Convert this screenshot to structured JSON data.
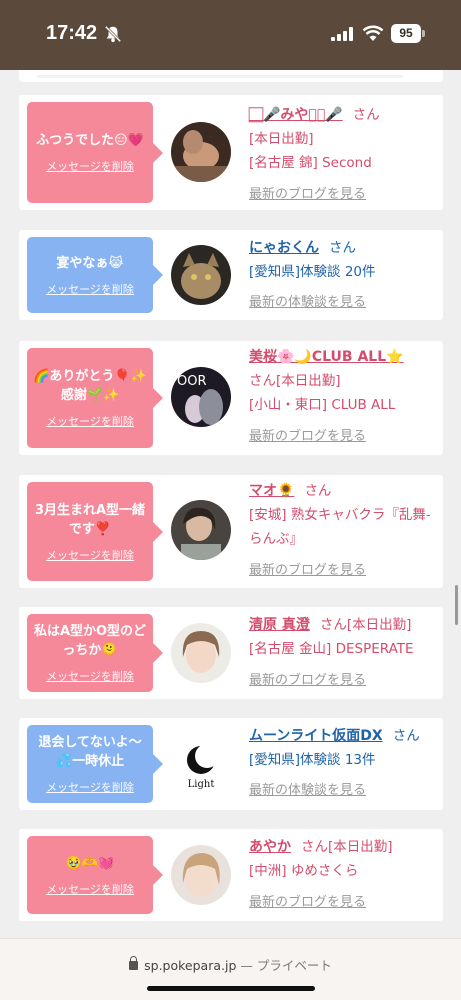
{
  "status": {
    "time": "17:42",
    "battery": "95"
  },
  "browser": {
    "domain": "sp.pokepara.jp",
    "privacy": "— プライベート"
  },
  "delete_label": "メッセージを削除",
  "items": [
    {
      "message": "ふつうでした😑💗",
      "name": "🏻‍🎤みやび🏻‍🎤",
      "san": "さん",
      "line2": "[本日出勤]",
      "line3": "[名古屋 錦] Second",
      "link": "最新のブログを見る"
    },
    {
      "message": "宴やなぁ😹",
      "name": "にゃおくん",
      "san": "さん",
      "line2": "[愛知県]体験談 20件",
      "link": "最新の体験談を見る"
    },
    {
      "message": "🌈ありがとう🎈✨感謝🌱✨",
      "name": "美桜🌸🌙CLUB ALL⭐️",
      "san": "さん",
      "line2": "[本日出勤]",
      "line3": "[小山・東口] CLUB ALL",
      "link": "最新のブログを見る"
    },
    {
      "message": "3月生まれA型一緒です❣️",
      "name": "マオ🌻",
      "san": "さん",
      "line2": "[安城] 熟女キャバクラ『乱舞-らんぶ』",
      "link": "最新のブログを見る"
    },
    {
      "message": "私はA型かO型のどっちか🫠",
      "name": "清原 真澄",
      "san": "さん",
      "line2": "[本日出勤]",
      "line3": "[名古屋 金山] DESPERATE",
      "link": "最新のブログを見る"
    },
    {
      "message": "退会してないよ〜💦一時休止",
      "name": "ムーンライト仮面DX",
      "san": "さん",
      "line2": "[愛知県]体験談 13件",
      "link": "最新の体験談を見る"
    },
    {
      "message": "🥹🫶💓",
      "name": "あやか",
      "san": "さん",
      "line2": "[本日出勤]",
      "line3": "[中洲] ゆめさくら",
      "link": "最新のブログを見る"
    }
  ],
  "avatar_texts": {
    "item3": "OOR",
    "item6": "Light"
  }
}
